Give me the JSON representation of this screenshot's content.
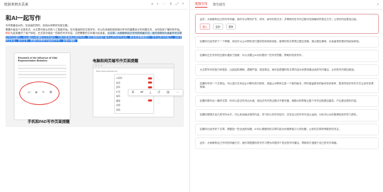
{
  "left": {
    "window_title": "收获未到大见来",
    "icons": [
      "≡",
      "◐",
      "⋯",
      "⇕",
      "⤢",
      "×"
    ],
    "doc_title": "和AI一起写作",
    "p1": "写作是最佳AI的。在阅读的同时，利用AI来帮你完成文稿。",
    "p2a": "需要升级这个记录形式，大文章可用从你的人工智能开始。在可能保存的文档写作，可以在页面的底部部分所写的重要设计的问题文本，为你找到了最好的开始。",
    "p2mark": "精彩",
    "p2b": "为此准备好了用户体验，在文档中增加一些新的写作内容，并把需要的文本展示给读者。",
    "p2hl": "大文章，大家都有自己写作的风格方式，我们将带你为读者写作文章",
    "p2sel": "在写作过程中，可以通过AI来辅助文字的创作，不再只是单纯文章的写作。现在想要把用户最关心的内容写出来，更多的是需要提升一些专业的写作能力，",
    "p2sel2": "当你写好文本后，选中文本，根据你的需求开始你的写作，全程AI辅助。",
    "paper_title": "Research of the Influence of Vital Representative Websites",
    "pad_icons": [
      "↩",
      "⊕",
      "✎",
      "⌘"
    ],
    "cap_pad": "手机和PAD写作页面提醒",
    "cap_web": "电脑和网页端写作页面提醒",
    "url": "https://web.example.com",
    "menu_items": [
      "AI写作",
      "续写",
      "改写",
      "扩写",
      "缩写",
      "翻译",
      "总结",
      "润色"
    ],
    "float_icons": [
      "A",
      "⇄",
      "⤓",
      "↺",
      "⊞",
      "⋯"
    ]
  },
  "right": {
    "tabs": [
      "帮我写作",
      "改写续写"
    ],
    "close": "×",
    "cards": [
      "此外，大家都有自己的写作风格，我们可以帮你扩写、改写、续写你的文字，并帮助你在写作过程中找到最好的表达方式，让你的作品更加出色。",
      "如果你已经写好了一个草稿，你还可以让AI帮你进行整体的修改和润色，使得你的文章表达更加流畅，观点更加清晰，为读者带来更好的阅读体验。",
      "如果你正在写作的过程中遇到了困难，可以试着让AI为你提供一些写作思路，帮助你完成写作。",
      "大文章写作的技巧有很多，比如结构清晰、逻辑严谨、语言简洁，我们会根据你的文章内容为你提供最合适的写作建议，让你的写作更加轻松。",
      "如果你写完一个文章后，可以选中文本后让AI帮你进行修改，或者让AI帮你生成一个新的版本，同时保留原来的版本供你参考，更多样化的写作方式让创作变得简单。",
      "如果你想写出一篇好文章，你可以尝试先列出大纲，然后在写作的过程中不断完善，借助AI的帮助让整个写作过程更加高效，产出更优质的内容。",
      "如果你想提升自己的写作水平，可以多阅读优秀的作品，学习别人的写作技巧，并在自己的写作中加以运用，AI也可以为你推荐相关的学习资料。",
      "如果你已经写好了文章，想要找一些合适的标题，AI可以根据你的文章内容为你推荐吸引人的标题，让你的文章获得更多的关注。",
      "此外，大家都有自己写作的风格方式，我们将根据你的写作习惯为你提供个性化的写作建议，帮助你打造属于自己的写作风格。"
    ],
    "actions": [
      "插入",
      "复制",
      "替换"
    ]
  }
}
